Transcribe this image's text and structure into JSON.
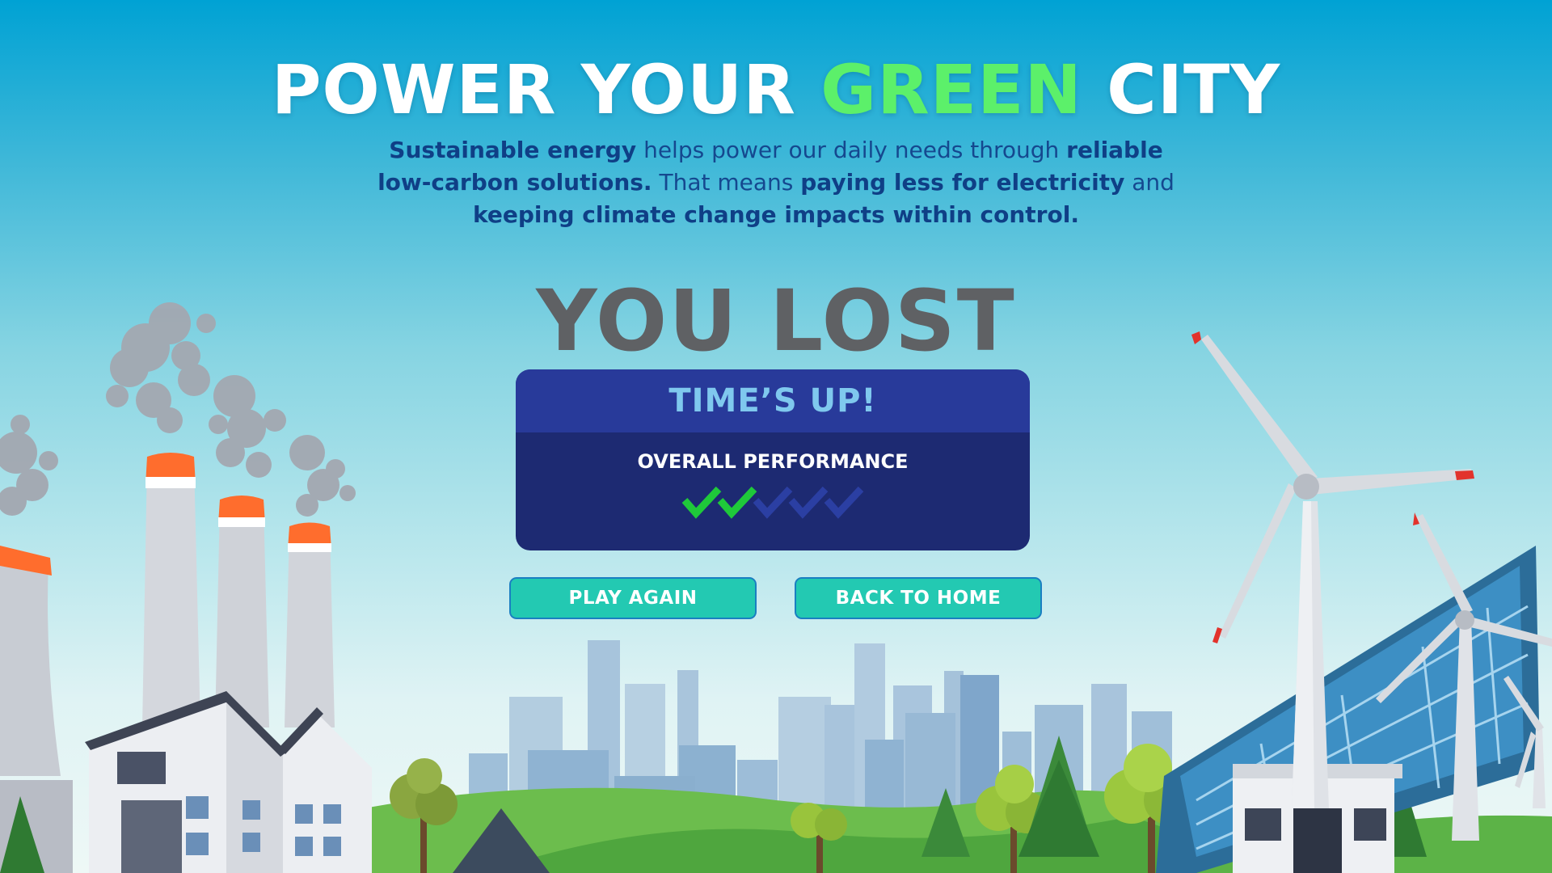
{
  "header": {
    "title_part1": "POWER YOUR ",
    "title_highlight": "GREEN",
    "title_part2": " CITY",
    "intro": {
      "b1": "Sustainable energy",
      "t1": " helps power our daily needs through ",
      "b2": "reliable low-carbon solutions.",
      "t2": " That means ",
      "b3": "paying less for electricity",
      "t3": " and ",
      "b4": "keeping climate change impacts within control."
    }
  },
  "result": {
    "heading": "YOU LOST",
    "panel_title": "TIME’S UP!",
    "performance_label": "OVERALL PERFORMANCE",
    "performance_score": 2,
    "performance_max": 5
  },
  "buttons": {
    "play_again": "PLAY AGAIN",
    "back_to_home": "BACK TO HOME"
  },
  "colors": {
    "sky_top": "#00a2d4",
    "title_green": "#5cf06a",
    "panel_header": "#283a9a",
    "panel_body": "#1d2a72",
    "button": "#23c9b2",
    "check_on": "#1fc93a",
    "check_off": "#2b3fa3"
  }
}
